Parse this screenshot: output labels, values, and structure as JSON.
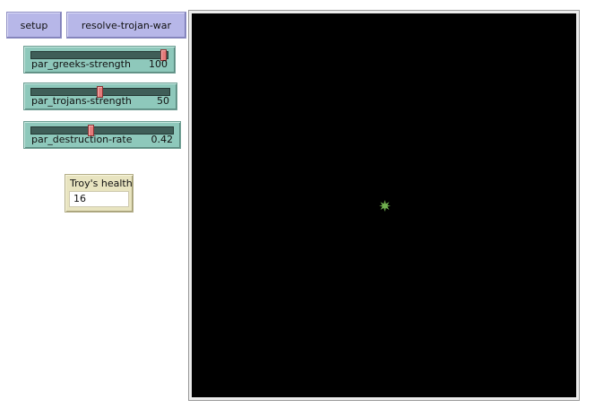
{
  "buttons": {
    "setup": "setup",
    "resolve": "resolve-trojan-war"
  },
  "sliders": [
    {
      "label": "par_greeks-strength",
      "value": "100",
      "fraction": 1.0
    },
    {
      "label": "par_trojans-strength",
      "value": "50",
      "fraction": 0.5
    },
    {
      "label": "par_destruction-rate",
      "value": "0.42",
      "fraction": 0.42
    }
  ],
  "monitor": {
    "label": "Troy's health",
    "value": "16"
  },
  "world": {
    "background_color": "#000000",
    "agent_icon": "star-icon",
    "agent_color": "#6fae4e"
  }
}
